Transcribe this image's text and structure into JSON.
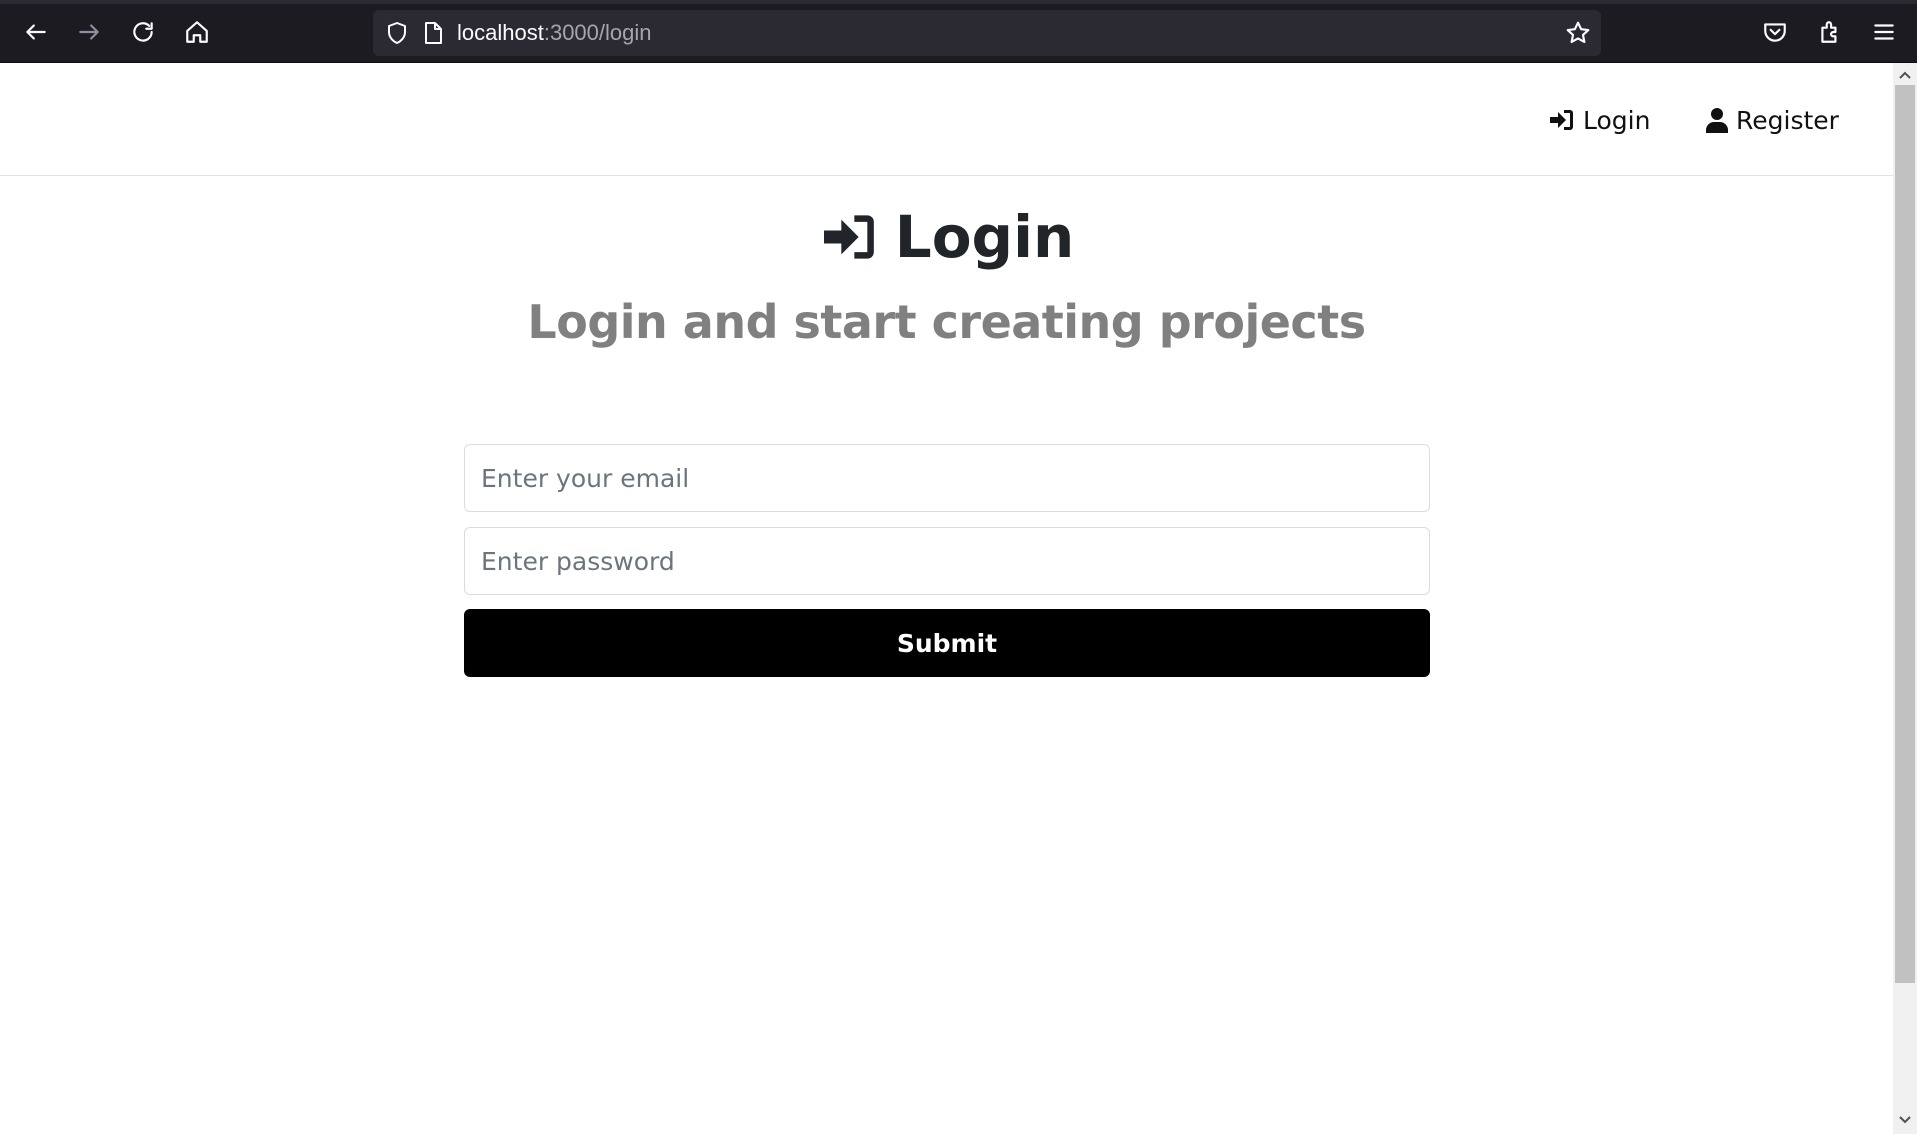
{
  "browser": {
    "url_host": "localhost",
    "url_path": ":3000/login",
    "icons": [
      "back-icon",
      "forward-icon",
      "reload-icon",
      "home-icon",
      "shield-icon",
      "page-icon",
      "star-icon",
      "pocket-icon",
      "extensions-icon",
      "menu-icon"
    ]
  },
  "nav": {
    "login_label": "Login",
    "register_label": "Register"
  },
  "main": {
    "title": "Login",
    "subtitle": "Login and start creating projects",
    "email_placeholder": "Enter your email",
    "password_placeholder": "Enter password",
    "submit_label": "Submit"
  },
  "colors": {
    "chrome_bg": "#1c1b22",
    "urlbar_bg": "#2b2a33",
    "heading": "#212529",
    "subheading": "#808080",
    "button_bg": "#000000"
  }
}
